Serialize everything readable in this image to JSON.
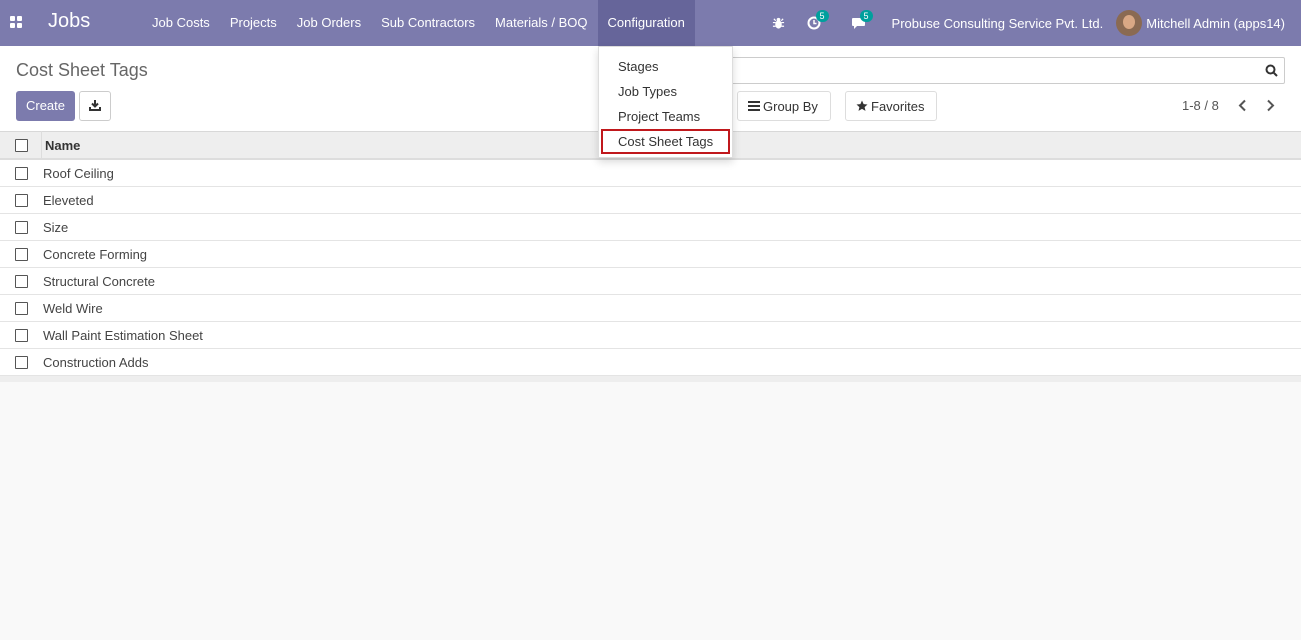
{
  "navbar": {
    "app_title": "Jobs",
    "menu": [
      {
        "label": "Job Costs"
      },
      {
        "label": "Projects"
      },
      {
        "label": "Job Orders"
      },
      {
        "label": "Sub Contractors"
      },
      {
        "label": "Materials / BOQ"
      },
      {
        "label": "Configuration"
      }
    ],
    "activities_count": "5",
    "messages_count": "5",
    "company": "Probuse Consulting Service Pvt. Ltd.",
    "user": "Mitchell Admin (apps14)",
    "color": "#7c7bad"
  },
  "control": {
    "breadcrumb": "Cost Sheet Tags",
    "create_label": "Create",
    "search_placeholder": "",
    "group_by_label": "Group By",
    "favorites_label": "Favorites",
    "pager": "1-8 / 8"
  },
  "list": {
    "column_name": "Name",
    "rows": [
      {
        "name": "Roof Ceiling"
      },
      {
        "name": "Eleveted"
      },
      {
        "name": "Size"
      },
      {
        "name": "Concrete Forming"
      },
      {
        "name": "Structural Concrete"
      },
      {
        "name": "Weld Wire"
      },
      {
        "name": "Wall Paint Estimation Sheet"
      },
      {
        "name": "Construction Adds"
      }
    ]
  },
  "config_dropdown": {
    "items": [
      {
        "label": "Stages"
      },
      {
        "label": "Job Types"
      },
      {
        "label": "Project Teams"
      },
      {
        "label": "Cost Sheet Tags"
      }
    ],
    "highlight_color": "#c0181c"
  }
}
